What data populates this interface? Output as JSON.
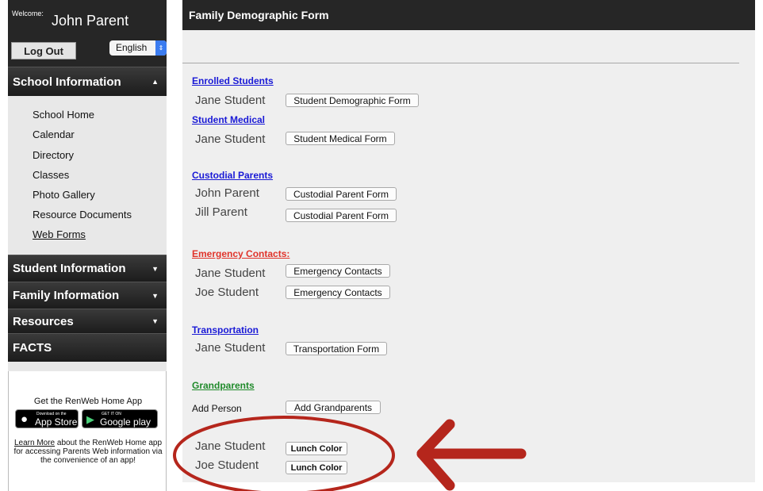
{
  "sidebar": {
    "welcome_small": "Welcome:",
    "user_name": "John Parent",
    "logout_label": "Log Out",
    "language": "English",
    "sections": [
      {
        "label": "School Information",
        "caret": "▲"
      },
      {
        "label": "Student Information",
        "caret": "▼"
      },
      {
        "label": "Family Information",
        "caret": "▼"
      },
      {
        "label": "Resources",
        "caret": "▼"
      },
      {
        "label": "FACTS",
        "caret": ""
      }
    ],
    "school_items": [
      "School Home",
      "Calendar",
      "Directory",
      "Classes",
      "Photo Gallery",
      "Resource Documents",
      "Web Forms"
    ],
    "app": {
      "title": "Get the RenWeb Home App",
      "appstore_small": "Download on the",
      "appstore_big": "App Store",
      "googleplay_small": "GET IT ON",
      "googleplay_big": "Google play",
      "learn_more": "Learn More",
      "description": " about the RenWeb Home app for accessing Parents Web information via the convenience of an app!"
    }
  },
  "main": {
    "title": "Family Demographic Form",
    "enrolled": {
      "heading": "Enrolled Students",
      "rows": [
        {
          "name": "Jane Student",
          "button": "Student Demographic Form"
        }
      ]
    },
    "medical": {
      "heading": "Student Medical",
      "rows": [
        {
          "name": "Jane Student",
          "button": "Student Medical Form"
        }
      ]
    },
    "custodial": {
      "heading": "Custodial Parents",
      "rows": [
        {
          "name": "John Parent",
          "button": "Custodial Parent Form"
        },
        {
          "name": "Jill Parent",
          "button": "Custodial Parent Form"
        }
      ]
    },
    "emergency": {
      "heading": "Emergency Contacts:",
      "rows": [
        {
          "name": "Jane Student",
          "button": "Emergency Contacts"
        },
        {
          "name": "Joe Student",
          "button": "Emergency Contacts"
        }
      ]
    },
    "transportation": {
      "heading": "Transportation",
      "rows": [
        {
          "name": "Jane Student",
          "button": "Transportation Form"
        }
      ]
    },
    "grandparents": {
      "heading": "Grandparents",
      "rows": [
        {
          "name": "Add Person",
          "button": "Add Grandparents"
        }
      ]
    },
    "lunch": {
      "rows": [
        {
          "name": "Jane Student",
          "button": "Lunch Color"
        },
        {
          "name": "Joe Student",
          "button": "Lunch Color"
        }
      ]
    }
  },
  "colors": {
    "header_bg": "#262626",
    "link_blue": "#1a1ad6",
    "link_red": "#e0332a",
    "link_green": "#1f8a2a",
    "annotation_red": "#b5261c"
  }
}
